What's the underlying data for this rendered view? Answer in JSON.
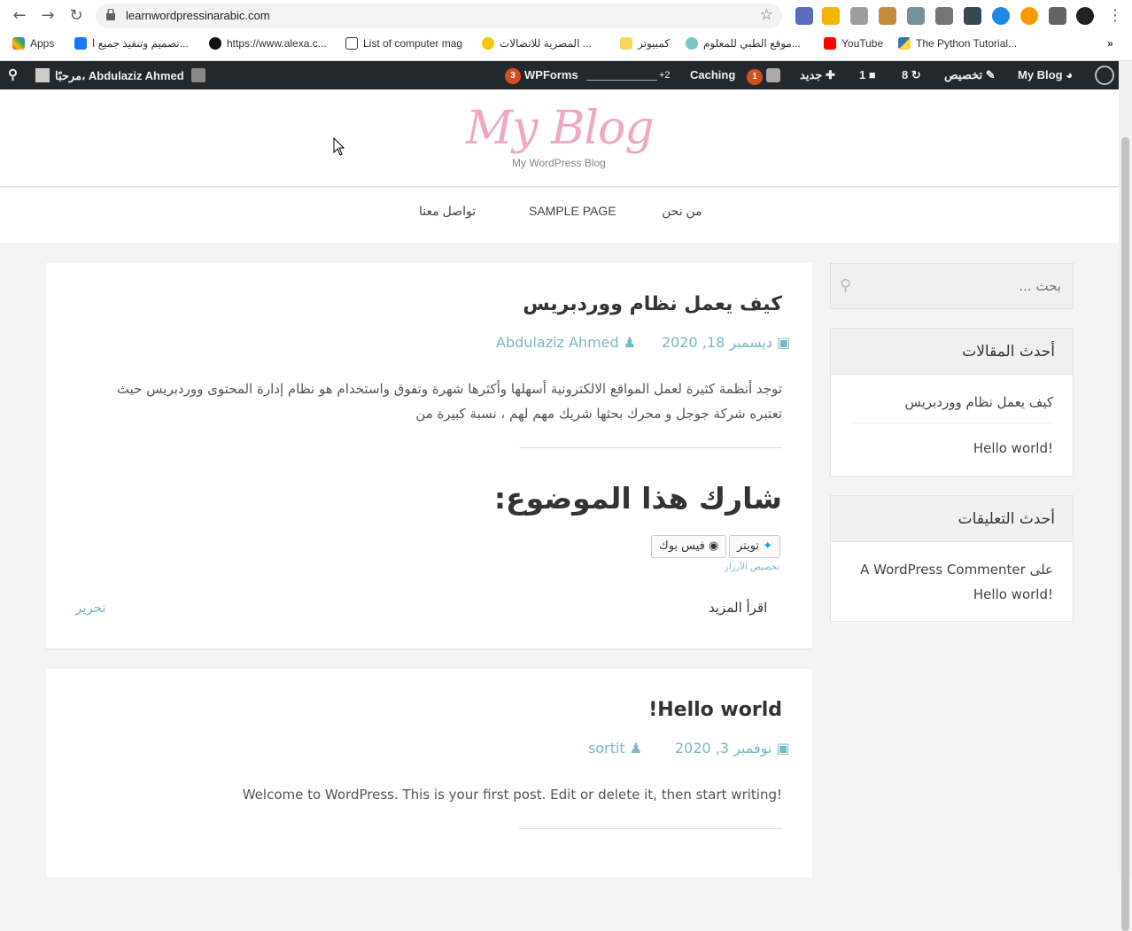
{
  "browser": {
    "url": "learnwordpressinarabic.com",
    "bookmarks": [
      "Apps",
      "تصميم وتنفيذ جميع ا...",
      "https://www.alexa.c...",
      "List of computer mag",
      "المصرية للاتصالات ...",
      "كمبيوتر",
      "موقع الطبي للمعلوم...",
      "YouTube",
      "The Python Tutorial..."
    ]
  },
  "adminbar": {
    "user": "مرحبًا، Abdulaziz Ahmed",
    "wpforms_count": "3",
    "wpforms": "WPForms",
    "plus2": "+2",
    "caching": "Caching",
    "yoast_count": "1",
    "new": "جديد",
    "comments": "1",
    "updates": "8",
    "customize": "تخصيص",
    "site": "My Blog"
  },
  "site": {
    "title": "My Blog",
    "tagline": "My WordPress Blog"
  },
  "menu": [
    "تواصل معنا",
    "SAMPLE PAGE",
    "من نحن"
  ],
  "post1": {
    "title": "كيف يعمل نظام ووردبريس",
    "author": "Abdulaziz Ahmed",
    "date": "ديسمبر 18, 2020",
    "excerpt": "توجد أنظمة كثيرة لعمل المواقع الالكترونية أسهلها وأكثرها شهرة وتفوق واستخدام هو نظام إدارة المحتوى ووردبريس حيث تعتبره شركة جوجل و محرك بحثها شريك مهم لهم ، نسبة كبيرة من",
    "share": "شارك هذا الموضوع:",
    "twitter": "تويتر",
    "facebook": "فيس بوك",
    "customize_buttons": "تخصيص الأزرار",
    "read_more": "اقرأ المزيد",
    "edit": "تحرير"
  },
  "post2": {
    "title": "Hello world!",
    "author": "sortit",
    "date": "نوفمبر 3, 2020",
    "excerpt": "Welcome to WordPress. This is your first post. Edit or delete it, then start writing!"
  },
  "sidebar": {
    "search_placeholder": "بحث ...",
    "recent_posts_title": "أحدث المقالات",
    "recent_posts": [
      "كيف يعمل نظام ووردبريس",
      "Hello world!"
    ],
    "recent_comments_title": "أحدث التعليقات",
    "comment_line1": "A WordPress Commenter على",
    "comment_line2": "Hello world!"
  }
}
